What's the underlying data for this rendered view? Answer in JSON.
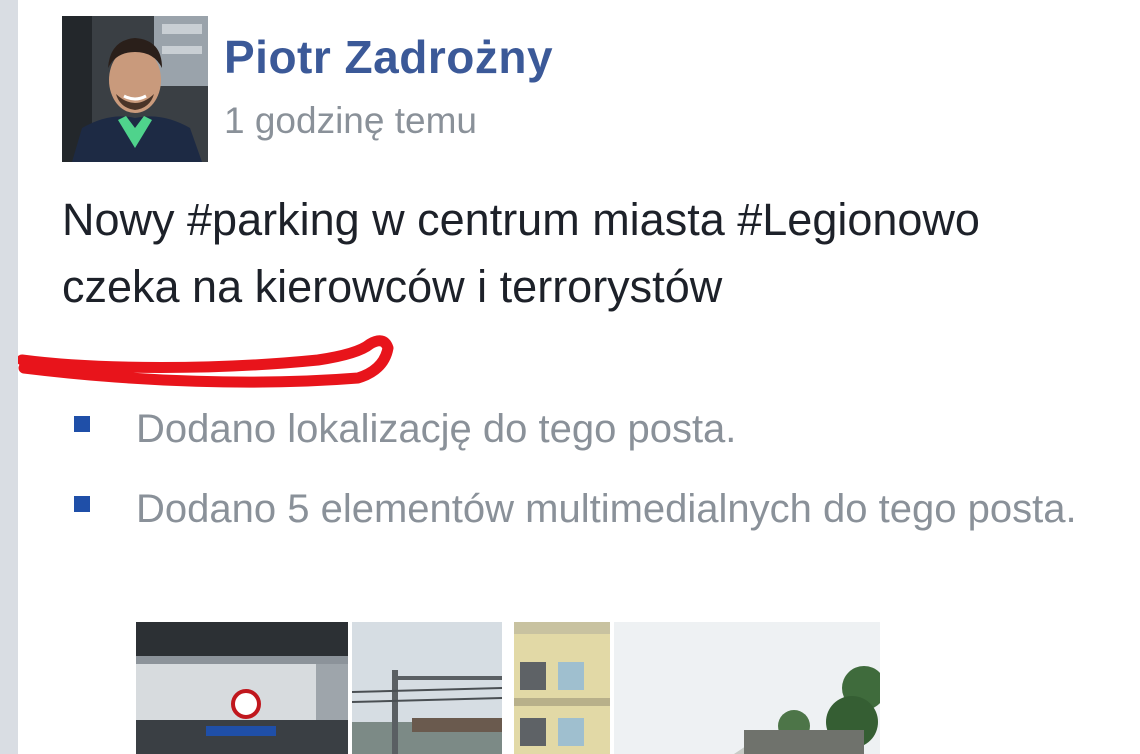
{
  "post": {
    "author_name": "Piotr Zadrożny",
    "timestamp": "1 godzinę temu",
    "text": "Nowy #parking w centrum miasta #Legionowo czeka na kierowców i terrorystów",
    "meta_items": [
      {
        "text": "Dodano lokalizację do tego posta."
      },
      {
        "text": "Dodano 5 elementów multimedialnych do tego posta."
      }
    ],
    "annotation_color": "#e8141b",
    "author_color": "#3b5998"
  },
  "media": {
    "photos": [
      {
        "subject": "parking-garage"
      },
      {
        "subject": "railway-overhead-lines"
      },
      {
        "subject": "apartment-building"
      },
      {
        "subject": "street-with-trees"
      }
    ]
  }
}
